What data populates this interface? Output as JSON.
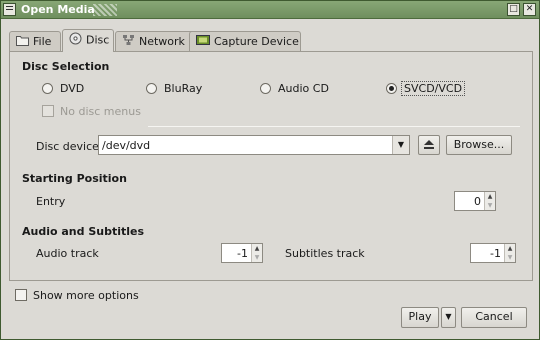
{
  "window": {
    "title": "Open Media"
  },
  "tabs": [
    {
      "label": "File",
      "icon": "folder-icon"
    },
    {
      "label": "Disc",
      "icon": "disc-icon"
    },
    {
      "label": "Network",
      "icon": "network-icon"
    },
    {
      "label": "Capture Device",
      "icon": "capture-device-icon"
    }
  ],
  "disc_selection": {
    "title": "Disc Selection",
    "options": [
      "DVD",
      "BluRay",
      "Audio CD",
      "SVCD/VCD"
    ],
    "selected": "SVCD/VCD",
    "no_disc_menus": "No disc menus",
    "device_label": "Disc device",
    "device_value": "/dev/dvd",
    "browse": "Browse..."
  },
  "starting_position": {
    "title": "Starting Position",
    "entry_label": "Entry",
    "entry_value": "0"
  },
  "audio_subtitles": {
    "title": "Audio and Subtitles",
    "audio_label": "Audio track",
    "audio_value": "-1",
    "subtitles_label": "Subtitles track",
    "subtitles_value": "-1"
  },
  "footer": {
    "show_more": "Show more options",
    "play": "Play",
    "cancel": "Cancel"
  }
}
